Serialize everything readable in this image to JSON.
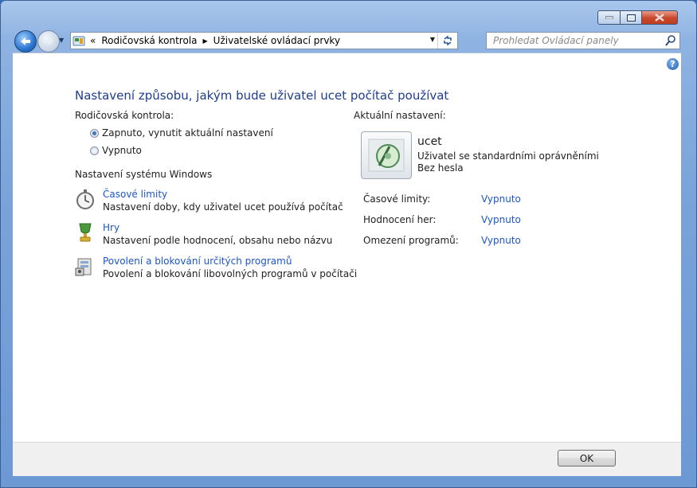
{
  "window": {
    "minimize_icon": "minimize-icon",
    "maximize_icon": "maximize-icon",
    "close_icon": "close-icon"
  },
  "nav": {
    "breadcrumb": [
      "Rodičovská kontrola",
      "Uživatelské ovládací prvky"
    ],
    "overflow_marker": "«",
    "search_placeholder": "Prohledat Ovládací panely"
  },
  "main": {
    "title": "Nastavení způsobu, jakým bude uživatel ucet počítač používat",
    "parental_label": "Rodičovská kontrola:",
    "radio_on": "Zapnuto, vynutit aktuální nastavení",
    "radio_off": "Vypnuto",
    "selected_radio": "on",
    "windows_settings_label": "Nastavení systému Windows",
    "tasks": [
      {
        "link": "Časové limity",
        "desc": "Nastavení doby, kdy uživatel ucet používá počítač",
        "icon": "stopwatch-icon"
      },
      {
        "link": "Hry",
        "desc": "Nastavení podle hodnocení, obsahu nebo názvu",
        "icon": "trophy-icon"
      },
      {
        "link": "Povolení a blokování určitých programů",
        "desc": "Povolení a blokování libovolných programů v počítači",
        "icon": "programs-icon"
      }
    ],
    "current_label": "Aktuální nastavení:",
    "user": {
      "name": "ucet",
      "type": "Uživatel se standardními oprávněními",
      "password": "Bez hesla"
    },
    "settings": [
      {
        "label": "Časové limity:",
        "value": "Vypnuto"
      },
      {
        "label": "Hodnocení her:",
        "value": "Vypnuto"
      },
      {
        "label": "Omezení programů:",
        "value": "Vypnuto"
      }
    ]
  },
  "footer": {
    "ok_label": "OK"
  },
  "colors": {
    "link": "#1c56c4",
    "title": "#1e3d8f",
    "frame": "#7aa3d9"
  }
}
